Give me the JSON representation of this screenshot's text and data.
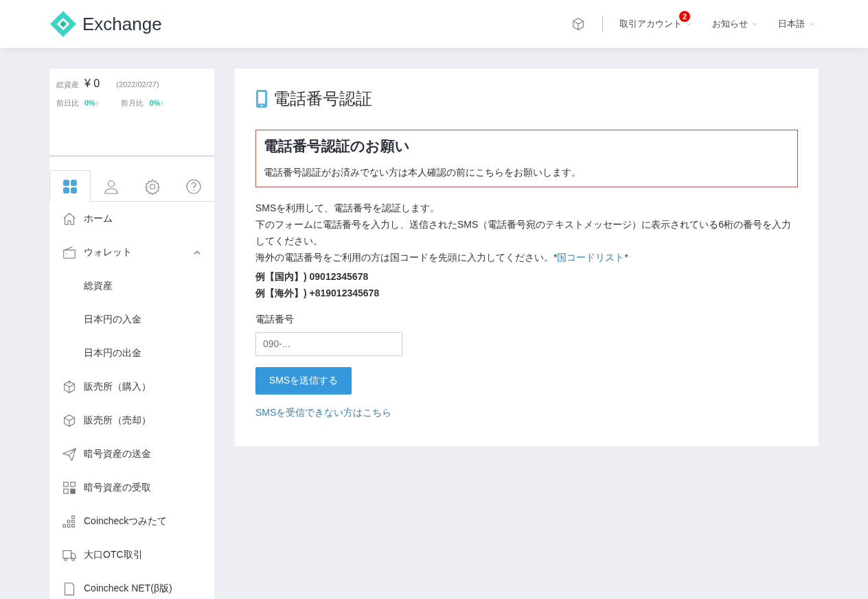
{
  "header": {
    "logo_text": "Exchange",
    "nav": [
      {
        "label": "取引アカウント",
        "badge": "2"
      },
      {
        "label": "お知らせ"
      },
      {
        "label": "日本語"
      }
    ]
  },
  "summary": {
    "total_label": "総資産",
    "total_value": "¥ 0",
    "date": "(2022/02/27)",
    "day_label": "前日比",
    "day_value": "0%↑",
    "month_label": "前月比",
    "month_value": "0%↑"
  },
  "tabs": [
    {
      "selected": true
    },
    {
      "selected": false
    },
    {
      "selected": false
    },
    {
      "selected": false
    }
  ],
  "menu": [
    {
      "label": "ホーム"
    },
    {
      "label": "ウォレット",
      "expanded": true,
      "children": [
        {
          "label": "総資産"
        },
        {
          "label": "日本円の入金"
        },
        {
          "label": "日本円の出金"
        }
      ]
    },
    {
      "label": "販売所（購入）"
    },
    {
      "label": "販売所（売却）"
    },
    {
      "label": "暗号資産の送金"
    },
    {
      "label": "暗号資産の受取"
    },
    {
      "label": "Coincheckつみたて"
    },
    {
      "label": "大口OTC取引"
    },
    {
      "label": "Coincheck NET(β版)"
    }
  ],
  "page": {
    "title": "電話番号認証",
    "alert": {
      "heading": "電話番号認証のお願い",
      "text": "電話番号認証がお済みでない方は本人確認の前にこちらをお願いします。"
    },
    "intro": [
      "SMSを利用して、電話番号を認証します。",
      "下のフォームに電話番号を入力し、送信されたSMS（電話番号宛のテキストメッセージ）に表示されている6桁の番号を入力してください。"
    ],
    "overseas": {
      "before": "海外の電話番号をご利用の方は国コードを先頭に入力してください。*",
      "link": "国コードリスト",
      "after": "*"
    },
    "examples": [
      "例【国内】) 09012345678",
      "例【海外】) +819012345678"
    ],
    "field": {
      "label": "電話番号",
      "placeholder": "090-..."
    },
    "button": "SMSを送信する",
    "help_link": "SMSを受信できない方はこちら"
  }
}
